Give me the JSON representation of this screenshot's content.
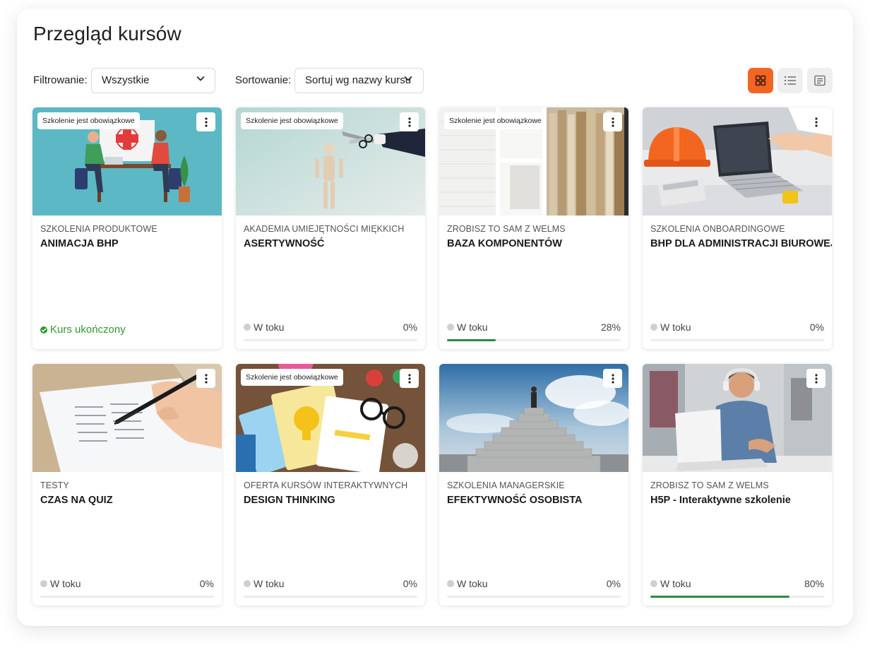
{
  "header": {
    "title": "Przegląd kursów"
  },
  "toolbar": {
    "filter_label": "Filtrowanie:",
    "filter_value": "Wszystkie",
    "sort_label": "Sortowanie:",
    "sort_value": "Sortuj wg nazwy kursu",
    "views": [
      {
        "icon": "grid-view-icon",
        "active": true
      },
      {
        "icon": "list-view-icon",
        "active": false
      },
      {
        "icon": "summary-view-icon",
        "active": false
      }
    ]
  },
  "colors": {
    "accent": "#f26522",
    "progress": "#2e8b3e",
    "completed": "#2e9a2e"
  },
  "courses": [
    {
      "badge": "Szkolenie jest obowiązkowe",
      "category": "SZKOLENIA PRODUKTOWE",
      "title": "ANIMACJA BHP",
      "status": "Kurs ukończony",
      "completed": true,
      "progress_label": "",
      "progress": null,
      "image": "meeting-illustration"
    },
    {
      "badge": "Szkolenie jest obowiązkowe",
      "category": "AKADEMIA UMIEJĘTNOŚCI MIĘKKICH",
      "title": "ASERTYWNOŚĆ",
      "status": "W toku",
      "completed": false,
      "progress_label": "0%",
      "progress": 0,
      "image": "puppet-scissors"
    },
    {
      "badge": "Szkolenie jest obowiązkowe",
      "category": "ZROBISZ TO SAM Z WeLMS",
      "title": "BAZA KOMPONENTÓW",
      "status": "W toku",
      "completed": false,
      "progress_label": "28%",
      "progress": 0.28,
      "image": "bookshelf"
    },
    {
      "badge": "",
      "category": "SZKOLENIA ONBOARDINGOWE",
      "title": "BHP DLA ADMINISTRACJI BIUROWEJ",
      "status": "W toku",
      "completed": false,
      "progress_label": "0%",
      "progress": 0,
      "image": "helmet-laptop"
    },
    {
      "badge": "",
      "category": "TESTY",
      "title": "CZAS NA QUIZ",
      "status": "W toku",
      "completed": false,
      "progress_label": "0%",
      "progress": 0,
      "image": "hand-pen-answer-sheet"
    },
    {
      "badge": "Szkolenie jest obowiązkowe",
      "category": "OFERTA KURSÓW INTERAKTYWNYCH",
      "title": "DESIGN THINKING",
      "status": "W toku",
      "completed": false,
      "progress_label": "0%",
      "progress": 0,
      "image": "sticky-notes-bulb"
    },
    {
      "badge": "",
      "category": "SZKOLENIA MANAGERSKIE",
      "title": "EFEKTYWNOŚĆ OSOBISTA",
      "status": "W toku",
      "completed": false,
      "progress_label": "0%",
      "progress": 0,
      "image": "stairs-sky"
    },
    {
      "badge": "",
      "category": "ZROBISZ TO SAM Z WeLMS",
      "title": "H5P - Interaktywne szkolenie",
      "status": "W toku",
      "completed": false,
      "progress_label": "80%",
      "progress": 0.8,
      "image": "man-headphones-laptop"
    }
  ]
}
